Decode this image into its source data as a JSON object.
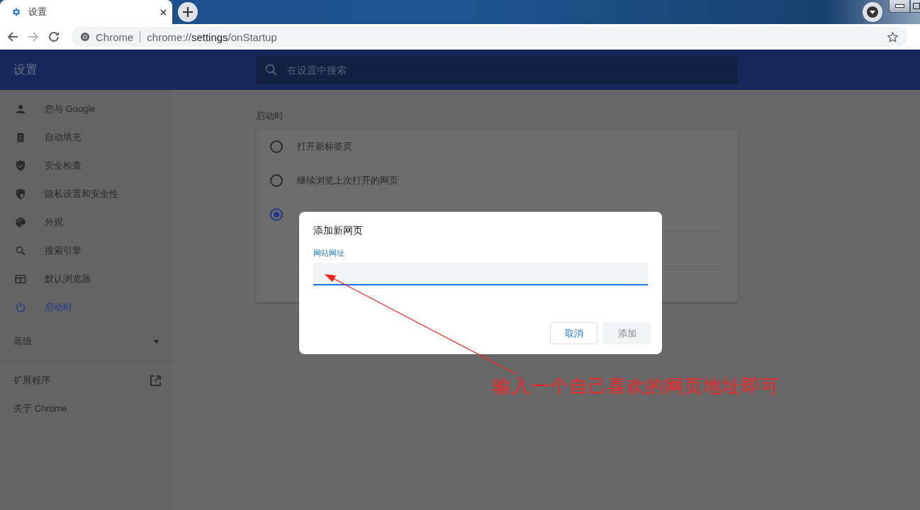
{
  "tab": {
    "title": "设置",
    "selected": true
  },
  "address_bar": {
    "origin": "Chrome",
    "url_prefix": "chrome://",
    "url_host": "settings",
    "url_path": "/onStartup"
  },
  "settings_header": {
    "title": "设置",
    "search": {
      "placeholder": "在设置中搜索"
    }
  },
  "sidebar": {
    "items": [
      {
        "label": "您与 Google",
        "selected": false
      },
      {
        "label": "自动填充",
        "selected": false
      },
      {
        "label": "安全检查",
        "selected": false
      },
      {
        "label": "隐私设置和安全性",
        "selected": false
      },
      {
        "label": "外观",
        "selected": false
      },
      {
        "label": "搜索引擎",
        "selected": false
      },
      {
        "label": "默认浏览器",
        "selected": false
      },
      {
        "label": "启动时",
        "selected": true
      }
    ],
    "advanced": {
      "label": "高级",
      "expanded": false
    },
    "extensions": "扩展程序",
    "about": "关于 Chrome"
  },
  "section": {
    "title": "启动时",
    "options": [
      {
        "label": "打开新标签页",
        "selected": false
      },
      {
        "label": "继续浏览上次打开的网页",
        "selected": false
      },
      {
        "selected": true
      }
    ]
  },
  "dialog": {
    "title": "添加新网页",
    "field_label": "网站网址",
    "buttons": [
      {
        "label": "取消",
        "disabled": false
      },
      {
        "label": "添加",
        "disabled": true
      }
    ]
  },
  "annotation": "输入一个自己喜欢的网页地址即可"
}
